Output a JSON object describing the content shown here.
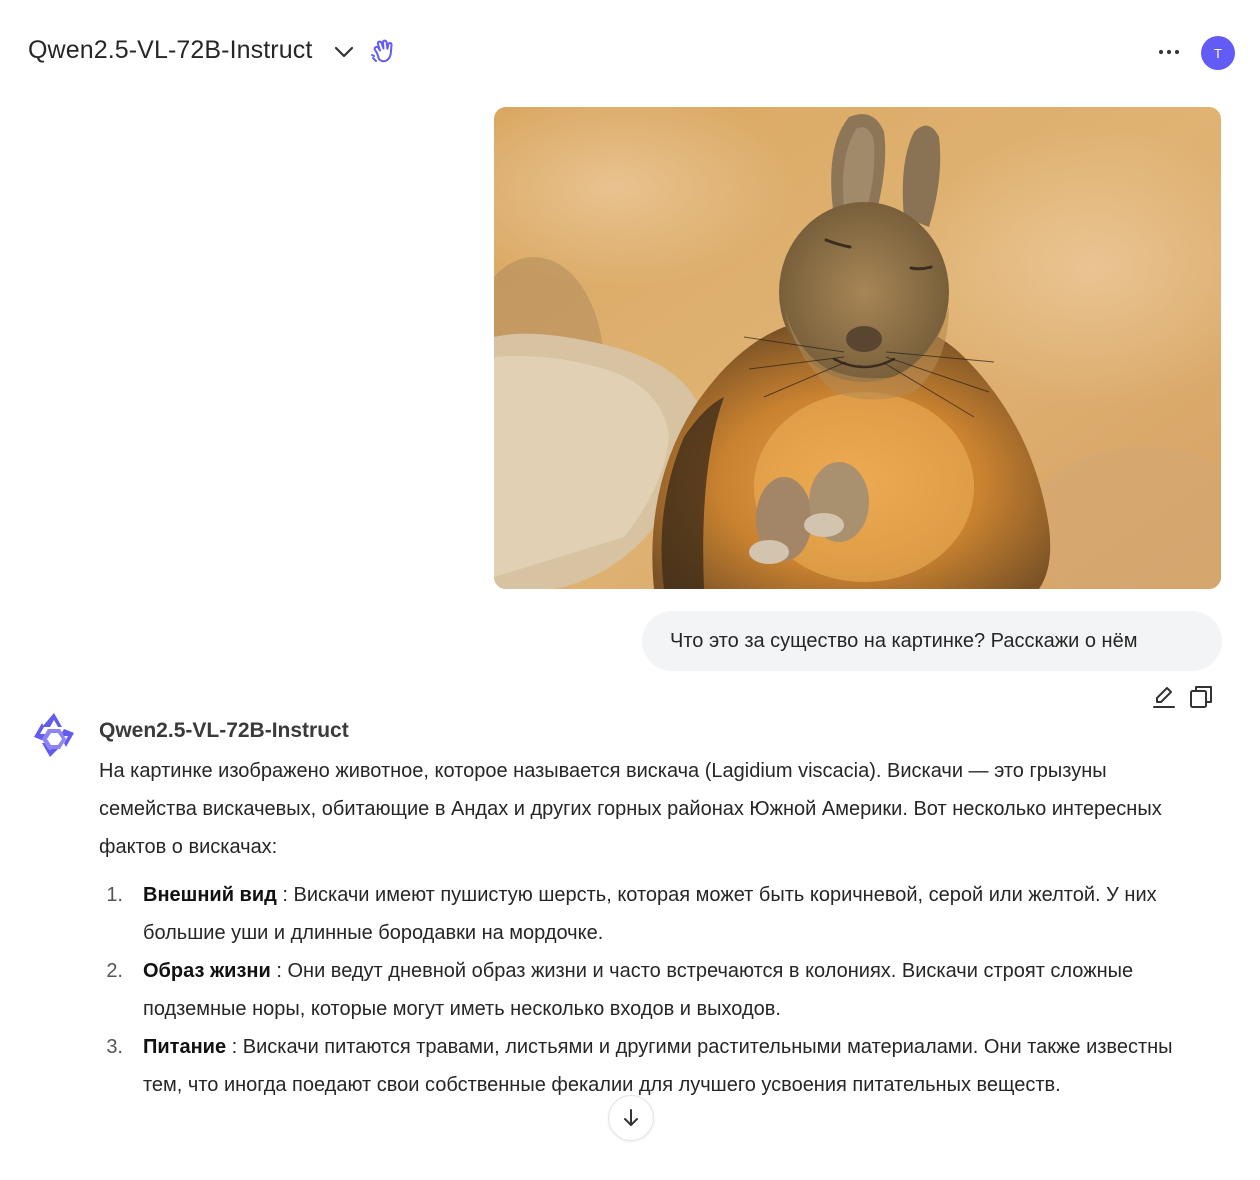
{
  "header": {
    "model_name": "Qwen2.5-VL-72B-Instruct",
    "avatar_initial": "T"
  },
  "user_message": {
    "text": "Что это за существо на картинке? Расскажи о нём"
  },
  "assistant": {
    "name": "Qwen2.5-VL-72B-Instruct",
    "intro": "На картинке изображено животное, которое называется вискача (Lagidium viscacia). Вискачи — это грызуны семейства вискачевых, обитающие в Андах и других горных районах Южной Америки. Вот несколько интересных фактов о вискачах:",
    "facts": [
      {
        "num": "1.",
        "title": "Внешний вид",
        "text": " : Вискачи имеют пушистую шерсть, которая может быть коричневой, серой или желтой. У них большие уши и длинные бородавки на мордочке."
      },
      {
        "num": "2.",
        "title": "Образ жизни",
        "text": " : Они ведут дневной образ жизни и часто встречаются в колониях. Вискачи строят сложные подземные норы, которые могут иметь несколько входов и выходов."
      },
      {
        "num": "3.",
        "title": "Питание",
        "text": " : Вискачи питаются травами, листьями и другими растительными материалами. Они также известны тем, что иногда поедают свои собственные фекалии для лучшего усвоения питательных веществ."
      }
    ]
  },
  "colors": {
    "accent": "#625bf5",
    "bubble_bg": "#f3f4f6",
    "logo": "#615ced"
  },
  "icons": {
    "chevron": "chevron-down-icon",
    "model": "hand-icon",
    "more": "more-icon",
    "edit": "edit-icon",
    "copy": "copy-icon",
    "scroll": "arrow-down-icon"
  }
}
